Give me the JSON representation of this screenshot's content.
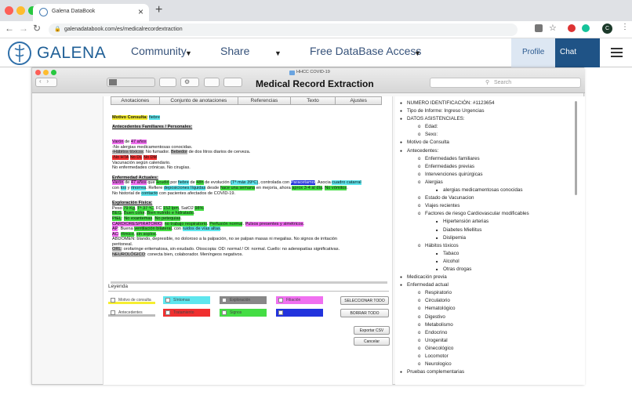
{
  "browser": {
    "tab_title": "Galena DataBook",
    "url": "galenadatabook.com/es/medicalrecordextraction",
    "profile_initial": "C",
    "new_tab": "+",
    "close": "×"
  },
  "site": {
    "brand": "GALENA",
    "nav": [
      {
        "label": "Community"
      },
      {
        "label": "Share"
      },
      {
        "label": "Free DataBase Access"
      }
    ],
    "profile": "Profile",
    "chat": "Chat"
  },
  "app": {
    "file_label": "HHCC COVID-19",
    "title": "Medical Record Extraction",
    "search_placeholder": "Search",
    "tabs": [
      "Anotaciones",
      "Conjunto de anotaciones",
      "Referencias",
      "Texto",
      "Ajustes"
    ]
  },
  "document": {
    "motivo_label": "Motivo Consulta:",
    "motivo_value": "fiebre",
    "antecedentes_heading": "Antecedentes Familiares / Personales:",
    "varon": "Varón",
    "de": " de ",
    "edad": "47 años",
    "alergias": "-No alergias medicamentosas conocidas.",
    "habitos_a": "-Hábitos tóxicos",
    "habitos_b": ": No fumador. ",
    "bebedor": "Bebedor",
    "habitos_c": " de dos litros diarios de cerveza.",
    "nohta": "-No HTA",
    "nodl": "No DL",
    "nodm": "No DM",
    "vacunacion": "Vacunación según calendario.",
    "noenf": "No enfermedades crónicas. No cirugías.",
    "enf_heading": "Enfermedad Actuales:",
    "ea1": [
      "Varón",
      " de ",
      "47 años",
      " que ",
      "acudió",
      " por ",
      "fiebre",
      " de ",
      "48h",
      " de evolución ",
      "(Tª máx 39ºC)",
      ", controlada con ",
      "Paracetamol",
      ". Asocia ",
      "cuadro catarral"
    ],
    "ea2": [
      "con ",
      "tos",
      " y ",
      "rinorrea",
      ". Refiere ",
      "deposiciones líquidas",
      " desde ",
      "hace una semana",
      " en mejoría, ahora ",
      "aprox 3-4 al día",
      ". ",
      "No vómitos",
      "."
    ],
    "ea3": [
      "No historial de ",
      "contacto",
      " con pacientes afectados de COVID-19."
    ],
    "exp_heading": "Exploración Física:",
    "ef1": [
      "Peso ",
      "79 Kg",
      ", ",
      "Tª 37 ºC",
      ", FC ",
      "152 lpm",
      ", SatO2 ",
      "98%"
    ],
    "ef2": [
      "BEG",
      ". ",
      "Buen color",
      ". ",
      "Bien nutrido e hidratado",
      "."
    ],
    "ef3": [
      "PIEL",
      ": ",
      "No exantemas",
      ". ",
      "No petequias",
      "."
    ],
    "ef4": [
      "CARDIORESPIRATORIO",
      ": ",
      "no trabajo respiratorio",
      ". ",
      "Perfusión normal",
      ". ",
      "Pulsos presentes y simétricos",
      "."
    ],
    "ef5": [
      "AP",
      ": Buena ",
      "ventilación bilateral",
      ", con ",
      "ruidos de vías altas",
      "."
    ],
    "ef6": [
      "AC",
      ": ",
      "rítmico",
      ", ",
      "sin soplos",
      "."
    ],
    "ef7": "ABDOMEN: blando, depresible, no doloroso a la palpación, no se palpan masas ni megalias. No signos de irritación",
    "ef8": "peritoneal.",
    "ef9": [
      "ORL",
      ": orofaringe eritematosa, sin exudado. Otoscopia: OD: normal / OI: normal. Cuello: no adenopatías significativas."
    ],
    "ef10": [
      "NEUROLÓGICO",
      ": conecta bien, colaborador. Meníngeos negativos."
    ]
  },
  "legend": {
    "title": "Leyenda",
    "items": [
      {
        "label": "Motivo de consulta",
        "color": "#f6ee30"
      },
      {
        "label": "Síntomas",
        "color": "#5ee6ee"
      },
      {
        "label": "Exploración",
        "color": "#888888"
      },
      {
        "label": "Filiación",
        "color": "#f070f0"
      },
      {
        "label": "Antecedentes",
        "color": "#bbbbbb"
      },
      {
        "label": "Tratamiento",
        "color": "#f03030"
      },
      {
        "label": "Signos",
        "color": "#44dd44"
      },
      {
        "label": "",
        "color": "#2233dd"
      }
    ],
    "select_all": "SELECCIONAR TODO",
    "clear_all": "BORRAR TODO",
    "export": "Exportar CSV",
    "cancel": "Cancelar"
  },
  "tree": [
    {
      "l": 1,
      "t": "NUMERO IDENTIFICACIÓN: #1123654"
    },
    {
      "l": 1,
      "t": "Tipo de Informe: Ingreso Urgencias"
    },
    {
      "l": 1,
      "t": "DATOS ASISTENCIALES:"
    },
    {
      "l": 2,
      "t": "Edad:"
    },
    {
      "l": 2,
      "t": "Sexo:"
    },
    {
      "l": 1,
      "t": "Motivo de Consulta"
    },
    {
      "l": 1,
      "t": "Antecedentes:"
    },
    {
      "l": 2,
      "t": "Enfermedades familiares"
    },
    {
      "l": 2,
      "t": "Enfermedades previas"
    },
    {
      "l": 2,
      "t": "Intervenciones quirúrgicas"
    },
    {
      "l": 2,
      "t": "Alergias"
    },
    {
      "l": 3,
      "t": "alergias medicamentosas conocidas"
    },
    {
      "l": 2,
      "t": "Estado de Vacunacion"
    },
    {
      "l": 2,
      "t": "Viajes recientes"
    },
    {
      "l": 2,
      "t": "Factores de riesgo Cardiovascular modificables"
    },
    {
      "l": 3,
      "t": "Hipertensión arterias"
    },
    {
      "l": 3,
      "t": "Diabetes Miellitus"
    },
    {
      "l": 3,
      "t": "Dislipemia"
    },
    {
      "l": 2,
      "t": "Hábitos tóxicos"
    },
    {
      "l": 3,
      "t": "Tabaco"
    },
    {
      "l": 3,
      "t": "Alcohol"
    },
    {
      "l": 3,
      "t": "Otras drogas"
    },
    {
      "l": 1,
      "t": "Medicación previa"
    },
    {
      "l": 1,
      "t": "Enfermedad actual"
    },
    {
      "l": 2,
      "t": "Respiratorio"
    },
    {
      "l": 2,
      "t": "Circulatorio"
    },
    {
      "l": 2,
      "t": "Hematológico"
    },
    {
      "l": 2,
      "t": "Digestivo"
    },
    {
      "l": 2,
      "t": "Metabolismo"
    },
    {
      "l": 2,
      "t": "Endocrino"
    },
    {
      "l": 2,
      "t": "Urogenital"
    },
    {
      "l": 2,
      "t": "Ginecológico"
    },
    {
      "l": 2,
      "t": "Locomotor"
    },
    {
      "l": 2,
      "t": "Neurologico"
    },
    {
      "l": 1,
      "t": "Pruebas complementarias"
    }
  ]
}
